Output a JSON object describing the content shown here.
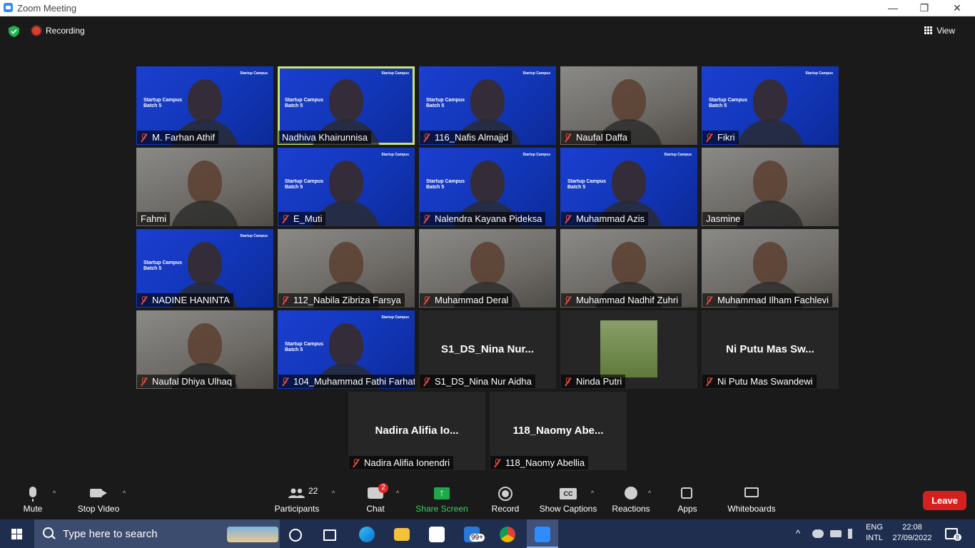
{
  "window": {
    "title": "Zoom Meeting",
    "minimize": "—",
    "restore": "❐",
    "close": "✕"
  },
  "topbar": {
    "recording_label": "Recording",
    "view_label": "View"
  },
  "slide": {
    "brand": "Startup Campus",
    "title_line1": "Startup Campus",
    "title_line2": "Batch 5"
  },
  "participants": [
    {
      "name": "M. Farhan Athif",
      "muted": true,
      "style": "blue",
      "display": ""
    },
    {
      "name": "Nadhiva Khairunnisa",
      "muted": false,
      "style": "blue",
      "display": "",
      "active_speaker": true
    },
    {
      "name": "116_Nafis Almajjd",
      "muted": true,
      "style": "blue",
      "display": ""
    },
    {
      "name": "Naufal Daffa",
      "muted": true,
      "style": "cam",
      "display": ""
    },
    {
      "name": "Fikri",
      "muted": true,
      "style": "blue",
      "display": ""
    },
    {
      "name": "Fahmi",
      "muted": false,
      "style": "cam",
      "display": ""
    },
    {
      "name": "E_Muti",
      "muted": true,
      "style": "blue",
      "display": ""
    },
    {
      "name": "Nalendra Kayana Pideksa",
      "muted": true,
      "style": "blue",
      "display": ""
    },
    {
      "name": "Muhammad Azis",
      "muted": true,
      "style": "blue",
      "display": ""
    },
    {
      "name": "Jasmine",
      "muted": false,
      "style": "cam",
      "display": ""
    },
    {
      "name": "NADINE HANINTA",
      "muted": true,
      "style": "blue",
      "display": ""
    },
    {
      "name": "112_Nabila Zibriza Farsya",
      "muted": true,
      "style": "cam",
      "display": ""
    },
    {
      "name": "Muhammad Deral",
      "muted": true,
      "style": "cam",
      "display": ""
    },
    {
      "name": "Muhammad Nadhif Zuhri",
      "muted": true,
      "style": "cam",
      "display": ""
    },
    {
      "name": "Muhammad Ilham Fachlevi",
      "muted": true,
      "style": "cam",
      "display": ""
    },
    {
      "name": "Naufal Dhiya Ulhaq",
      "muted": true,
      "style": "cam",
      "display": ""
    },
    {
      "name": "104_Muhammad Fathi Farhat",
      "muted": true,
      "style": "blue",
      "display": ""
    },
    {
      "name": "S1_DS_Nina Nur Aidha",
      "muted": true,
      "style": "dark",
      "display": "S1_DS_Nina  Nur..."
    },
    {
      "name": "Ninda Putri",
      "muted": true,
      "style": "photo",
      "display": ""
    },
    {
      "name": "Ni Putu Mas Swandewi",
      "muted": true,
      "style": "dark",
      "display": "Ni Putu Mas Sw..."
    },
    {
      "name": "Nadira Alifia Ionendri",
      "muted": true,
      "style": "dark",
      "display": "Nadira Alifia Io..."
    },
    {
      "name": "118_Naomy Abellia",
      "muted": true,
      "style": "dark",
      "display": "118_Naomy Abe..."
    }
  ],
  "toolbar": {
    "mute": "Mute",
    "stop_video": "Stop Video",
    "participants": "Participants",
    "participants_count": "22",
    "chat": "Chat",
    "chat_badge": "2",
    "share_screen": "Share Screen",
    "record": "Record",
    "show_captions": "Show Captions",
    "captions_icon": "CC",
    "reactions": "Reactions",
    "apps": "Apps",
    "whiteboards": "Whiteboards",
    "leave": "Leave",
    "colors": {
      "leave": "#d62020",
      "share": "#1ea84a",
      "active_speaker": "#c9e66b"
    }
  },
  "taskbar": {
    "search_placeholder": "Type here to search",
    "mail_badge": "99+",
    "lang_line1": "ENG",
    "lang_line2": "INTL",
    "time": "22:08",
    "date": "27/09/2022",
    "notif_count": "8"
  }
}
